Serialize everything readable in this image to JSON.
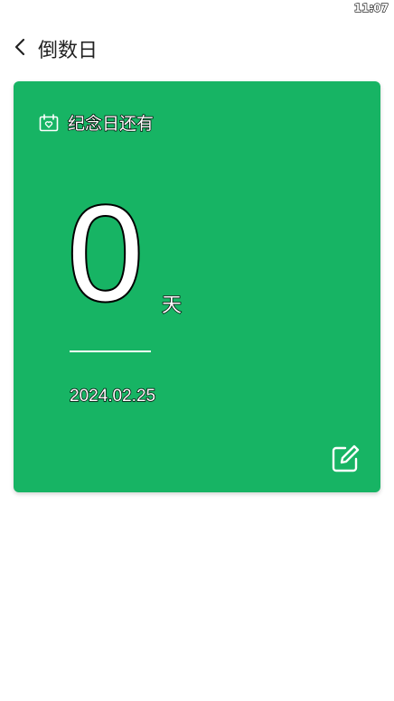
{
  "status_bar": {
    "time": "11:07"
  },
  "header": {
    "title": "倒数日",
    "back_icon": "chevron-left-icon"
  },
  "card": {
    "background_color": "#17b464",
    "icon": "calendar-heart-icon",
    "label": "纪念日还有",
    "days_count": "0",
    "days_unit": "天",
    "target_date": "2024.02.25",
    "edit_icon": "edit-icon"
  }
}
